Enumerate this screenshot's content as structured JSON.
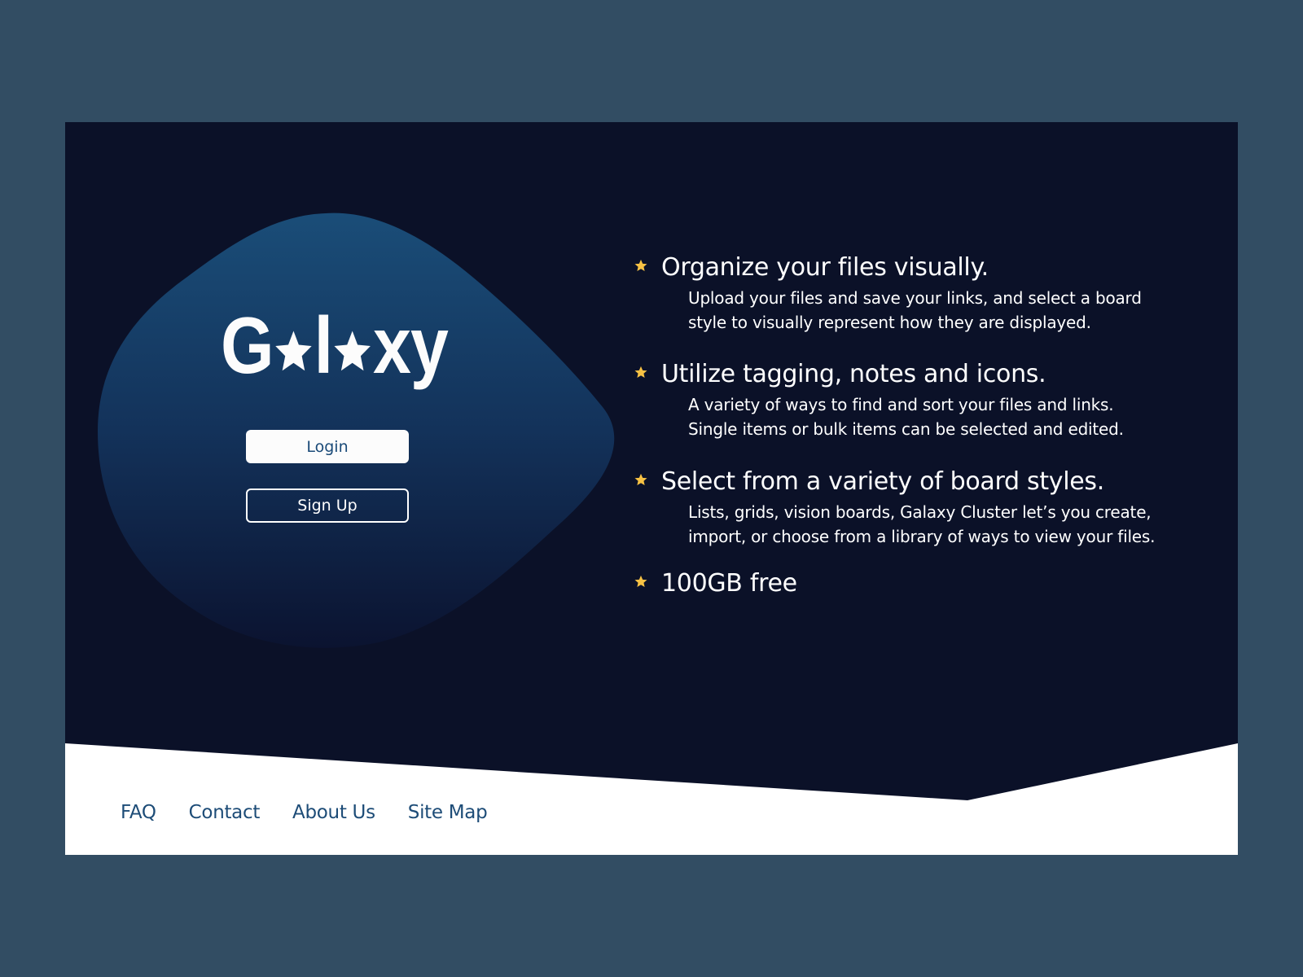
{
  "colors": {
    "page_bg": "#324d63",
    "hero_bg": "#0b1128",
    "blob_top": "#1a4d78",
    "blob_bottom": "#0b1330",
    "accent_star": "#f7c244",
    "footer_bg": "#ffffff",
    "footer_link": "#1d4c77",
    "login_text": "#1a4a78"
  },
  "brand": {
    "parts": [
      "G",
      "l",
      "xy"
    ],
    "full_name": "Galaxy",
    "star_glyph": "star-icon"
  },
  "auth": {
    "login_label": "Login",
    "signup_label": "Sign Up"
  },
  "features": [
    {
      "heading": "Organize your files visually.",
      "desc_lines": [
        "Upload your files and save your links, and select a board",
        "style to visually represent how they are displayed."
      ]
    },
    {
      "heading": "Utilize tagging, notes and icons.",
      "desc_lines": [
        "A variety of ways to find and sort your files and links.",
        "Single items or bulk items can be selected and edited."
      ]
    },
    {
      "heading": "Select from a variety of board styles.",
      "desc_lines": [
        "Lists, grids, vision boards, Galaxy Cluster let’s you create,",
        "import, or choose from a library of ways to view your files."
      ]
    },
    {
      "heading": "100GB free",
      "desc_lines": []
    }
  ],
  "footer": {
    "links": [
      "FAQ",
      "Contact",
      "About Us",
      "Site Map"
    ]
  }
}
